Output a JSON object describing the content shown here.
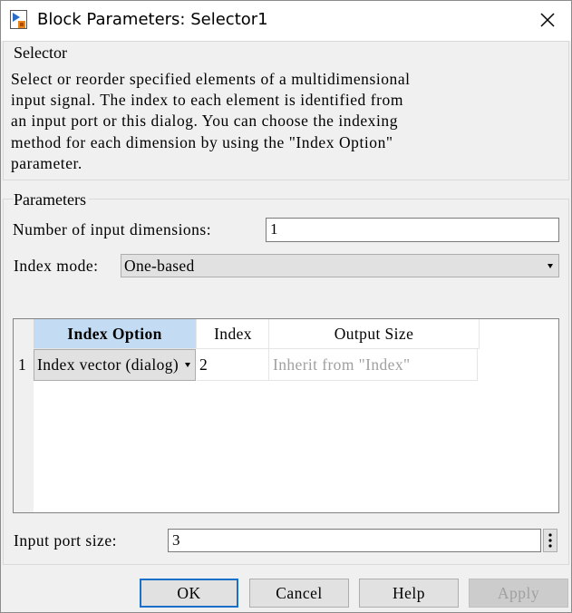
{
  "window": {
    "title": "Block Parameters: Selector1"
  },
  "selector_group": {
    "label": "Selector",
    "description_lines": [
      "Select or reorder specified elements of a multidimensional",
      "input signal. The index to each element is identified from",
      "an input port or this dialog. You can choose the indexing",
      "method for each dimension by using the \"Index Option\"",
      "parameter."
    ]
  },
  "parameters_group": {
    "label": "Parameters",
    "num_dims_label": "Number of input dimensions:",
    "num_dims_value": "1",
    "index_mode_label": "Index mode:",
    "index_mode_value": "One-based",
    "table": {
      "headers": [
        "Index Option",
        "Index",
        "Output Size"
      ],
      "rows": [
        {
          "num": "1",
          "index_option": "Index vector (dialog)",
          "index": "2",
          "output_size": "Inherit from \"Index\""
        }
      ]
    },
    "input_port_label": "Input port size:",
    "input_port_value": "3"
  },
  "buttons": {
    "ok": "OK",
    "cancel": "Cancel",
    "help": "Help",
    "apply": "Apply"
  },
  "colors": {
    "selected_header": "#c3dcf3",
    "disabled_text": "#a0a0a0",
    "focus_border": "#1a6fc8"
  }
}
